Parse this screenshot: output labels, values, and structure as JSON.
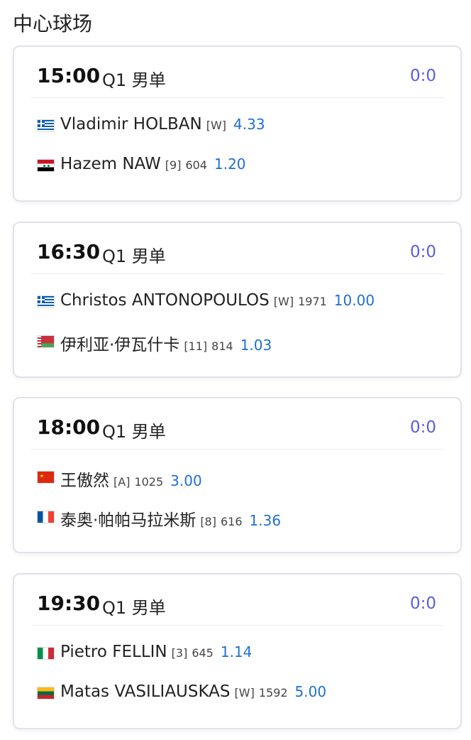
{
  "court": {
    "title": "中心球场"
  },
  "matches": [
    {
      "time": "15:00",
      "round": "Q1 男单",
      "score": "0:0",
      "players": [
        {
          "flag": "flag-greece",
          "name": "Vladimir HOLBAN",
          "seed": "[W]",
          "rank": "",
          "odds": "4.33"
        },
        {
          "flag": "flag-syria",
          "name": "Hazem NAW",
          "seed": "[9]",
          "rank": "604",
          "odds": "1.20"
        }
      ]
    },
    {
      "time": "16:30",
      "round": "Q1 男单",
      "score": "0:0",
      "players": [
        {
          "flag": "flag-greece",
          "name": "Christos ANTONOPOULOS",
          "seed": "[W]",
          "rank": "1971",
          "odds": "10.00"
        },
        {
          "flag": "flag-belarus",
          "name": "伊利亚·伊瓦什卡",
          "seed": "[11]",
          "rank": "814",
          "odds": "1.03"
        }
      ]
    },
    {
      "time": "18:00",
      "round": "Q1 男单",
      "score": "0:0",
      "players": [
        {
          "flag": "flag-china",
          "name": "王傲然",
          "seed": "[A]",
          "rank": "1025",
          "odds": "3.00"
        },
        {
          "flag": "flag-france",
          "name": "泰奥·帕帕马拉米斯",
          "seed": "[8]",
          "rank": "616",
          "odds": "1.36"
        }
      ]
    },
    {
      "time": "19:30",
      "round": "Q1 男单",
      "score": "0:0",
      "players": [
        {
          "flag": "flag-italy",
          "name": "Pietro FELLIN",
          "seed": "[3]",
          "rank": "645",
          "odds": "1.14"
        },
        {
          "flag": "flag-lithuania",
          "name": "Matas VASILIAUSKAS",
          "seed": "[W]",
          "rank": "1592",
          "odds": "5.00"
        }
      ]
    }
  ]
}
